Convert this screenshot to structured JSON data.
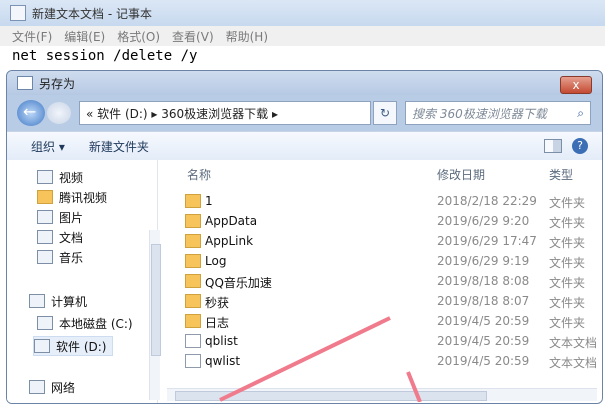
{
  "notepad": {
    "title": "新建文本文档 - 记事本",
    "menu": [
      "文件(F)",
      "编辑(E)",
      "格式(O)",
      "查看(V)",
      "帮助(H)"
    ],
    "content": "net session /delete /y"
  },
  "dialog": {
    "title": "另存为",
    "close_label": "x",
    "breadcrumb": "« 软件 (D:) ▸ 360极速浏览器下载 ▸",
    "search_placeholder": "搜索 360极速浏览器下载",
    "toolbar": {
      "organize": "组织 ▾",
      "new_folder": "新建文件夹"
    },
    "nav_items": [
      "视频",
      "腾讯视频",
      "图片",
      "文档",
      "音乐",
      "计算机",
      "本地磁盘 (C:)",
      "软件 (D:)",
      "网络"
    ],
    "columns": {
      "name": "名称",
      "date": "修改日期",
      "type": "类型"
    },
    "files": [
      {
        "name": "1",
        "date": "2018/2/18 22:29",
        "type": "文件夹",
        "kind": "folder"
      },
      {
        "name": "AppData",
        "date": "2019/6/29 9:20",
        "type": "文件夹",
        "kind": "folder"
      },
      {
        "name": "AppLink",
        "date": "2019/6/29 17:47",
        "type": "文件夹",
        "kind": "folder"
      },
      {
        "name": "Log",
        "date": "2019/6/29 9:19",
        "type": "文件夹",
        "kind": "folder"
      },
      {
        "name": "QQ音乐加速",
        "date": "2019/8/18 8:08",
        "type": "文件夹",
        "kind": "folder"
      },
      {
        "name": "秒获",
        "date": "2019/8/18 8:07",
        "type": "文件夹",
        "kind": "folder"
      },
      {
        "name": "日志",
        "date": "2019/4/5 20:59",
        "type": "文件夹",
        "kind": "folder"
      },
      {
        "name": "qblist",
        "date": "2019/4/5 20:59",
        "type": "文本文档",
        "kind": "text"
      },
      {
        "name": "qwlist",
        "date": "2019/4/5 20:59",
        "type": "文本文档",
        "kind": "text"
      }
    ]
  },
  "colors": {
    "accent_arrow": "#f07b8c",
    "folder": "#f6c45a"
  }
}
